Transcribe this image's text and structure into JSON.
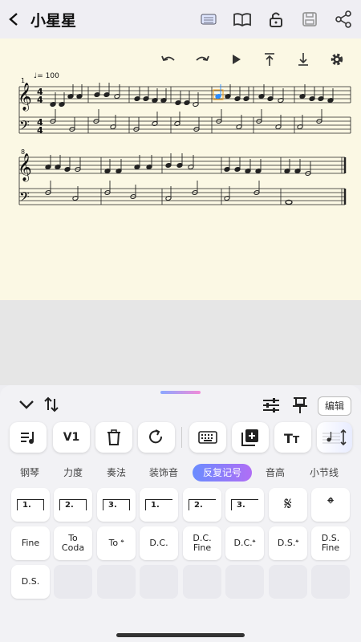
{
  "header": {
    "title": "小星星"
  },
  "score": {
    "tempo": "♩= 100",
    "measure_numbers": [
      "1",
      "8"
    ]
  },
  "panel": {
    "edit_label": "编辑",
    "voice_label": "V1",
    "tabs": [
      "钢琴",
      "力度",
      "奏法",
      "装饰音",
      "反复记号",
      "音高",
      "小节线"
    ],
    "active_tab": "反复记号",
    "symbols": {
      "volta1": "1.",
      "volta2": "2.",
      "volta3": "3.",
      "fine": "Fine",
      "to_coda_1": "To",
      "to_coda_2": "Coda",
      "to_coda_sym": "To 𝄌",
      "dc": "D.C.",
      "dc_fine_1": "D.C.",
      "dc_fine_2": "Fine",
      "dc_coda": "D.C.𝄌",
      "ds_coda": "D.S.𝄌",
      "ds_fine_1": "D.S.",
      "ds_fine_2": "Fine",
      "ds": "D.S.",
      "segno": "𝄋",
      "coda": "𝄌"
    }
  },
  "colors": {
    "score_bg": "#fbf8e4",
    "accent_start": "#6a8cff",
    "accent_end": "#b06ef5",
    "selected_note": "#2a8cff"
  }
}
